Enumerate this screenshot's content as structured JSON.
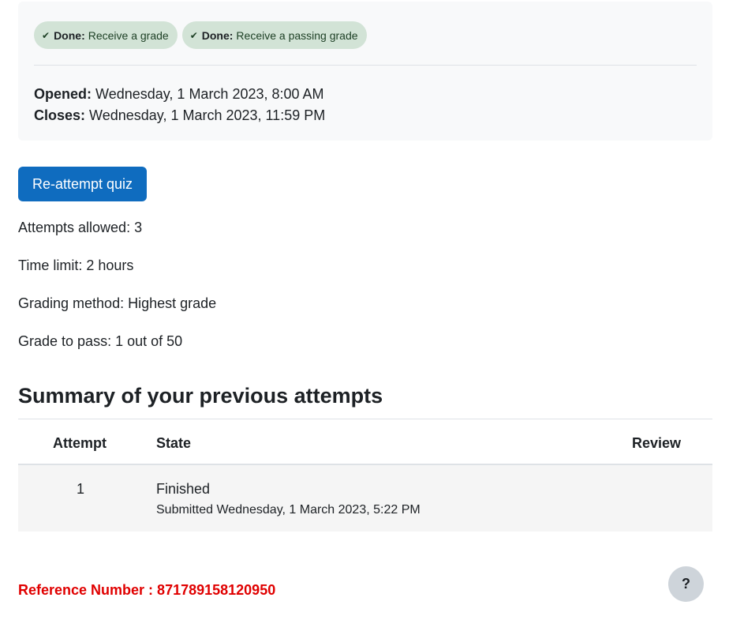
{
  "completion": {
    "badges": [
      {
        "status": "Done:",
        "condition": "Receive a grade",
        "icon": "check-icon"
      },
      {
        "status": "Done:",
        "condition": "Receive a passing grade",
        "icon": "check-icon"
      }
    ],
    "badge_color": "#d2e3d6"
  },
  "dates": {
    "opened_label": "Opened:",
    "opened_value": "Wednesday, 1 March 2023, 8:00 AM",
    "closes_label": "Closes:",
    "closes_value": "Wednesday, 1 March 2023, 11:59 PM"
  },
  "actions": {
    "reattempt_label": "Re-attempt quiz",
    "button_color": "#0f6cbf"
  },
  "quiz_info": {
    "attempts_allowed": "Attempts allowed: 3",
    "time_limit": "Time limit: 2 hours",
    "grading_method": "Grading method: Highest grade",
    "grade_to_pass": "Grade to pass: 1 out of 50"
  },
  "summary": {
    "title": "Summary of your previous attempts",
    "headers": {
      "attempt": "Attempt",
      "state": "State",
      "review": "Review"
    },
    "rows": [
      {
        "attempt": "1",
        "state": "Finished",
        "submitted": "Submitted Wednesday, 1 March 2023, 5:22 PM"
      }
    ]
  },
  "footer": {
    "reference_number": "Reference Number : 871789158120950",
    "reference_color": "#e00000",
    "help_label": "?"
  }
}
